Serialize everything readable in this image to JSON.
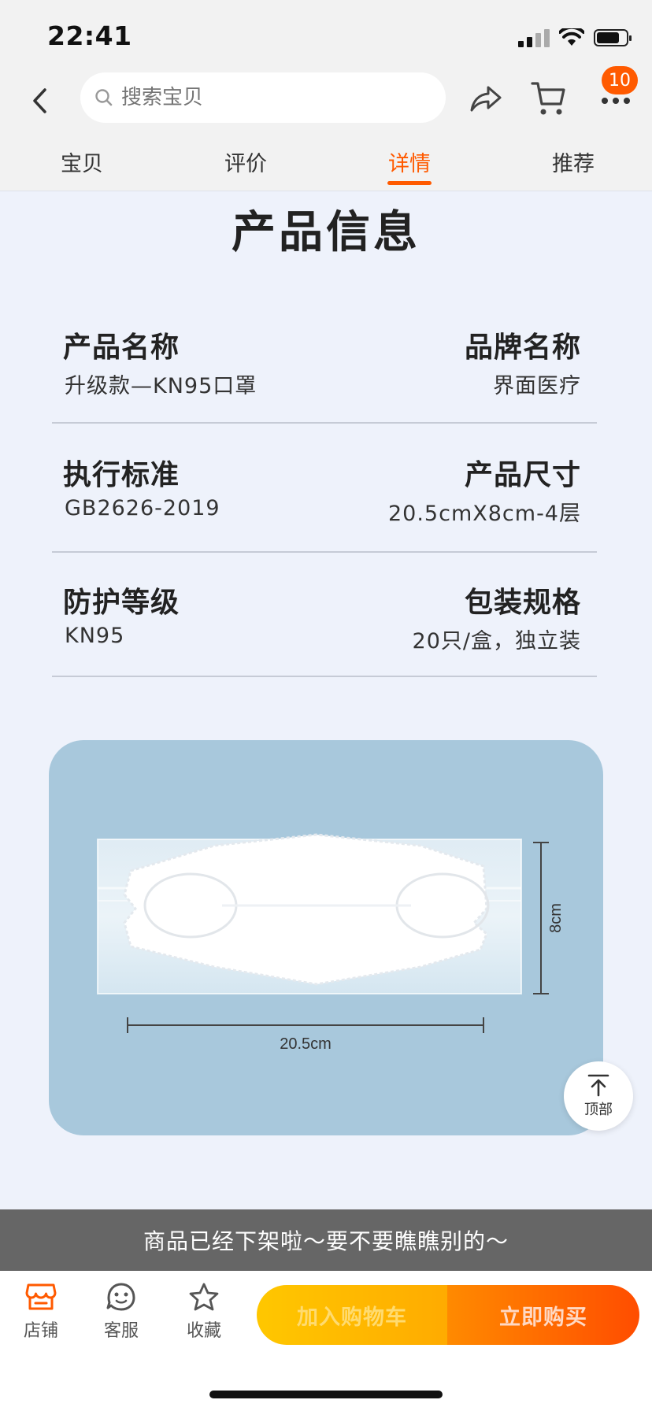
{
  "status_bar": {
    "time": "22:41"
  },
  "header": {
    "search_placeholder": "搜索宝贝",
    "cart_badge": "10",
    "icons": {
      "back": "chevron-left-icon",
      "share": "share-icon",
      "cart": "cart-icon",
      "more": "more-icon"
    }
  },
  "tabs": [
    {
      "label": "宝贝",
      "active": false
    },
    {
      "label": "评价",
      "active": false
    },
    {
      "label": "详情",
      "active": true
    },
    {
      "label": "推荐",
      "active": false
    }
  ],
  "section_title": "产品信息",
  "specs": [
    {
      "left_label": "产品名称",
      "left_value": "升级款—KN95口罩",
      "right_label": "品牌名称",
      "right_value": "界面医疗"
    },
    {
      "left_label": "执行标准",
      "left_value": "GB2626-2019",
      "right_label": "产品尺寸",
      "right_value": "20.5cmX8cm-4层"
    },
    {
      "left_label": "防护等级",
      "left_value": "KN95",
      "right_label": "包装规格",
      "right_value": "20只/盒，独立装"
    }
  ],
  "product_image": {
    "width_label": "20.5cm",
    "height_label": "8cm"
  },
  "back_to_top_label": "顶部",
  "notice": "商品已经下架啦～要不要瞧瞧别的～",
  "bottom_bar": {
    "shop_label": "店铺",
    "service_label": "客服",
    "favorite_label": "收藏",
    "add_to_cart_label": "加入购物车",
    "buy_now_label": "立即购买"
  },
  "colors": {
    "accent": "#ff5a00",
    "page_bg": "#eef2fb",
    "card_bg": "#a8c8dc",
    "cart_button": "#ffbe00",
    "buy_button": "#ff6a00",
    "notice_bg": "#666666"
  }
}
